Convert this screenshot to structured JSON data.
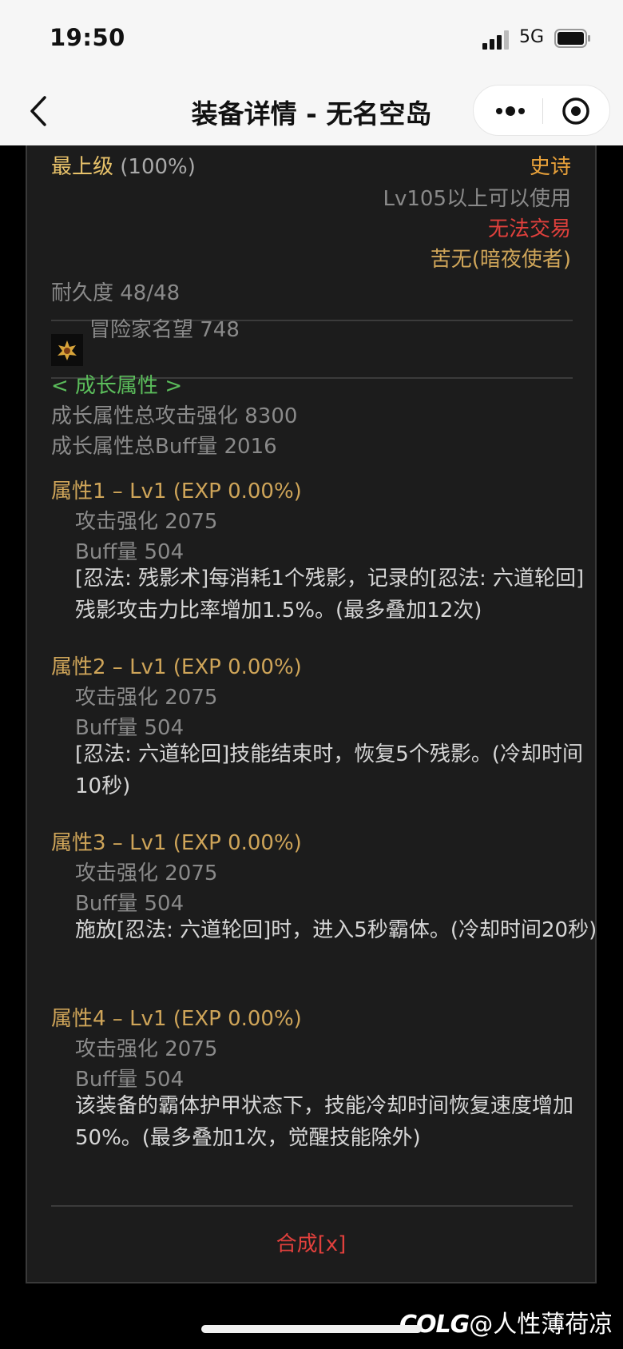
{
  "status": {
    "time": "19:50",
    "network": "5G"
  },
  "nav": {
    "title": "装备详情 - 无名空岛"
  },
  "item": {
    "grade": "最上级",
    "grade_percent": "(100%)",
    "rarity": "史诗",
    "level_req": "Lv105以上可以使用",
    "trade": "无法交易",
    "class": "苦无(暗夜使者)",
    "durability": "耐久度 48/48",
    "reputation": "冒险家名望 748",
    "growth_header": "< 成长属性 >",
    "growth_total_attack": "成长属性总攻击强化 8300",
    "growth_total_buff": "成长属性总Buff量 2016",
    "attributes": [
      {
        "title": "属性1 – Lv1 (EXP 0.00%)",
        "attack": "攻击强化   2075",
        "buff": "Buff量   504",
        "desc": "[忍法: 残影术]每消耗1个残影，记录的[忍法: 六道轮回]残影攻击力比率增加1.5%。(最多叠加12次)"
      },
      {
        "title": "属性2 – Lv1 (EXP 0.00%)",
        "attack": "攻击强化   2075",
        "buff": "Buff量   504",
        "desc": "[忍法: 六道轮回]技能结束时，恢复5个残影。(冷却时间10秒)"
      },
      {
        "title": "属性3 – Lv1 (EXP 0.00%)",
        "attack": "攻击强化   2075",
        "buff": "Buff量   504",
        "desc": "施放[忍法: 六道轮回]时，进入5秒霸体。(冷却时间20秒)"
      },
      {
        "title": "属性4 – Lv1 (EXP 0.00%)",
        "attack": "攻击强化   2075",
        "buff": "Buff量   504",
        "desc": "该装备的霸体护甲状态下，技能冷却时间恢复速度增加50%。(最多叠加1次，觉醒技能除外)"
      }
    ],
    "synth": "合成[x]"
  },
  "watermark": {
    "logo": "COLG",
    "text": "@人性薄荷凉"
  },
  "colors": {
    "grade": "#e8c26a",
    "rarity": "#e8a13a",
    "trade": "#e0403c",
    "growth": "#5bbd5b",
    "attr": "#cfa559"
  }
}
